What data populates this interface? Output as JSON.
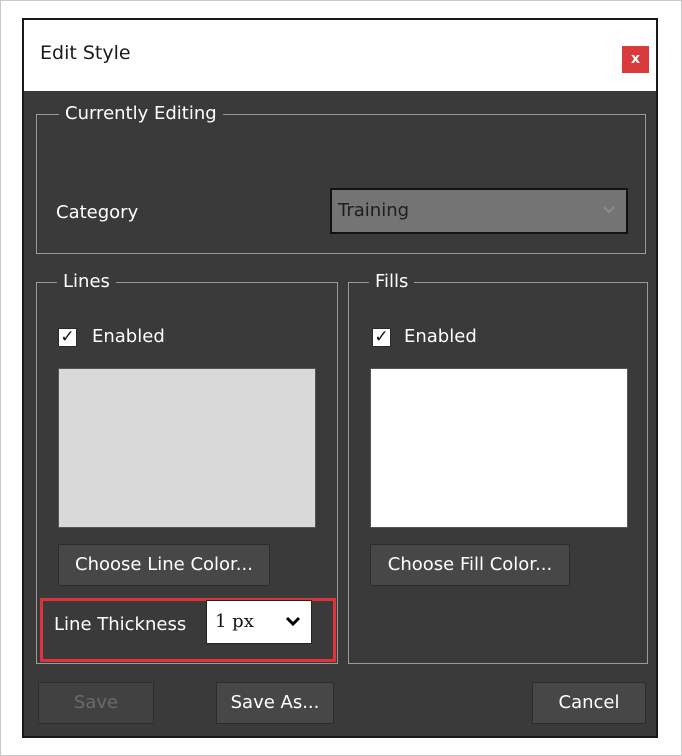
{
  "window": {
    "title": "Edit Style",
    "close_label": "x"
  },
  "currently_editing": {
    "legend": "Currently Editing",
    "category_label": "Category",
    "category_value": "Training"
  },
  "lines": {
    "legend": "Lines",
    "enabled_label": "Enabled",
    "enabled_checked": true,
    "swatch_color": "#d9d9d9",
    "choose_color_label": "Choose Line Color...",
    "thickness_label": "Line Thickness",
    "thickness_value": "1 px"
  },
  "fills": {
    "legend": "Fills",
    "enabled_label": "Enabled",
    "enabled_checked": true,
    "swatch_color": "#ffffff",
    "choose_color_label": "Choose Fill Color..."
  },
  "footer": {
    "save_label": "Save",
    "save_as_label": "Save As...",
    "cancel_label": "Cancel"
  },
  "colors": {
    "dialog_bg": "#3a3a3a",
    "highlight": "#e0323c",
    "close_button": "#d93a3a"
  }
}
